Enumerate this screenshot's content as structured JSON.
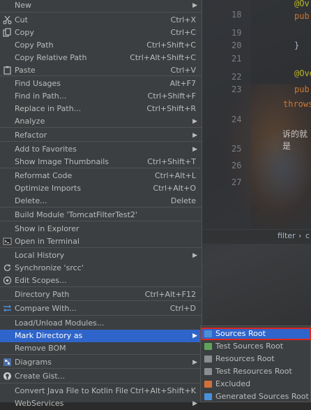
{
  "editor": {
    "line_numbers": [
      "18",
      "19",
      "20",
      "21",
      "22",
      "23",
      "24",
      "25",
      "26",
      "27"
    ],
    "code_lines": [
      "@Ov",
      "pub",
      "}",
      "@Ove",
      "pub",
      "throws",
      "诉的就是"
    ],
    "breadcrumb": {
      "item": "filter",
      "sep": "›",
      "more": "c"
    }
  },
  "menu": {
    "items": [
      {
        "label": "New",
        "shortcut": "",
        "submenu": true,
        "icon": ""
      },
      {
        "label": "Cut",
        "shortcut": "Ctrl+X",
        "submenu": false,
        "icon": "scissors-icon"
      },
      {
        "label": "Copy",
        "shortcut": "Ctrl+C",
        "submenu": false,
        "icon": "copy-icon"
      },
      {
        "label": "Copy Path",
        "shortcut": "Ctrl+Shift+C",
        "submenu": false,
        "icon": ""
      },
      {
        "label": "Copy Relative Path",
        "shortcut": "Ctrl+Alt+Shift+C",
        "submenu": false,
        "icon": ""
      },
      {
        "label": "Paste",
        "shortcut": "Ctrl+V",
        "submenu": false,
        "icon": "clipboard-icon"
      },
      {
        "label": "Find Usages",
        "shortcut": "Alt+F7",
        "submenu": false,
        "icon": ""
      },
      {
        "label": "Find in Path...",
        "shortcut": "Ctrl+Shift+F",
        "submenu": false,
        "icon": ""
      },
      {
        "label": "Replace in Path...",
        "shortcut": "Ctrl+Shift+R",
        "submenu": false,
        "icon": ""
      },
      {
        "label": "Analyze",
        "shortcut": "",
        "submenu": true,
        "icon": ""
      },
      {
        "label": "Refactor",
        "shortcut": "",
        "submenu": true,
        "icon": ""
      },
      {
        "label": "Add to Favorites",
        "shortcut": "",
        "submenu": true,
        "icon": ""
      },
      {
        "label": "Show Image Thumbnails",
        "shortcut": "Ctrl+Shift+T",
        "submenu": false,
        "icon": ""
      },
      {
        "label": "Reformat Code",
        "shortcut": "Ctrl+Alt+L",
        "submenu": false,
        "icon": ""
      },
      {
        "label": "Optimize Imports",
        "shortcut": "Ctrl+Alt+O",
        "submenu": false,
        "icon": ""
      },
      {
        "label": "Delete...",
        "shortcut": "Delete",
        "submenu": false,
        "icon": ""
      },
      {
        "label": "Build Module 'TomcatFilterTest2'",
        "shortcut": "",
        "submenu": false,
        "icon": ""
      },
      {
        "label": "Show in Explorer",
        "shortcut": "",
        "submenu": false,
        "icon": ""
      },
      {
        "label": "Open in Terminal",
        "shortcut": "",
        "submenu": false,
        "icon": "terminal-icon"
      },
      {
        "label": "Local History",
        "shortcut": "",
        "submenu": true,
        "icon": ""
      },
      {
        "label": "Synchronize 'srcc'",
        "shortcut": "",
        "submenu": false,
        "icon": "sync-icon"
      },
      {
        "label": "Edit Scopes...",
        "shortcut": "",
        "submenu": false,
        "icon": "scopes-icon"
      },
      {
        "label": "Directory Path",
        "shortcut": "Ctrl+Alt+F12",
        "submenu": false,
        "icon": ""
      },
      {
        "label": "Compare With...",
        "shortcut": "Ctrl+D",
        "submenu": false,
        "icon": "compare-icon"
      },
      {
        "label": "Load/Unload Modules...",
        "shortcut": "",
        "submenu": false,
        "icon": ""
      },
      {
        "label": "Mark Directory as",
        "shortcut": "",
        "submenu": true,
        "icon": "",
        "active": true
      },
      {
        "label": "Remove BOM",
        "shortcut": "",
        "submenu": false,
        "icon": ""
      },
      {
        "label": "Diagrams",
        "shortcut": "",
        "submenu": true,
        "icon": "diagram-icon"
      },
      {
        "label": "Create Gist...",
        "shortcut": "",
        "submenu": false,
        "icon": "github-icon"
      },
      {
        "label": "Convert Java File to Kotlin File",
        "shortcut": "Ctrl+Alt+Shift+K",
        "submenu": false,
        "icon": ""
      },
      {
        "label": "WebServices",
        "shortcut": "",
        "submenu": true,
        "icon": ""
      }
    ]
  },
  "submenu": {
    "items": [
      {
        "label": "Sources Root",
        "color": "#4a90d9",
        "active": true
      },
      {
        "label": "Test Sources Root",
        "color": "#5fa35a"
      },
      {
        "label": "Resources Root",
        "color": "#8a8e93"
      },
      {
        "label": "Test Resources Root",
        "color": "#8a8e93"
      },
      {
        "label": "Excluded",
        "color": "#d0703a"
      },
      {
        "label": "Generated Sources Root",
        "color": "#4a90d9"
      }
    ]
  },
  "colors": {
    "menu_bg": "#3c3f41",
    "highlight": "#2f65ca",
    "outline": "#e0241c"
  }
}
